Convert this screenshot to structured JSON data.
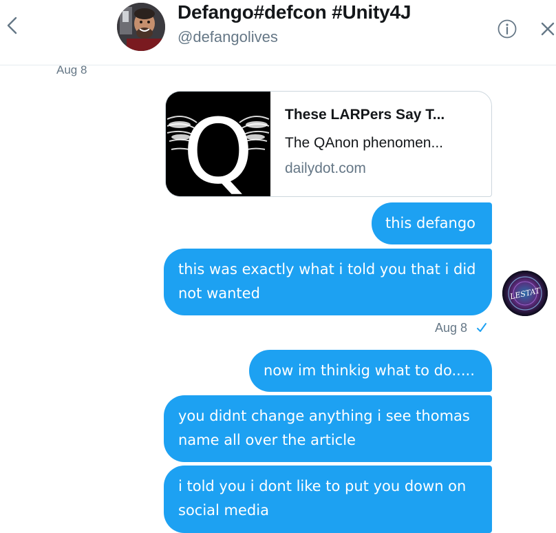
{
  "header": {
    "title": "Defango#defcon #Unity4J",
    "handle": "@defangolives",
    "back_icon": "chevron-left-icon",
    "info_icon": "info-icon",
    "close_icon": "close-icon"
  },
  "date_top": "Aug 8",
  "link_card": {
    "title": "These LARPers Say T...",
    "description": "The QAnon phenomen...",
    "domain": "dailydot.com",
    "thumb_letter": "Q"
  },
  "messages": [
    {
      "text": "this defango"
    },
    {
      "text": "this was exactly what i told you that i did not wanted"
    },
    {
      "text": "now im thinkig what to do....."
    },
    {
      "text": "you didnt change anything i see thomas name all over the article"
    },
    {
      "text": "i told you i dont like to put you down on social media"
    }
  ],
  "timestamp": "Aug 8",
  "read_icon": "checkmark-icon",
  "small_avatar_text": "LESTAT",
  "colors": {
    "bubble": "#1da1f2",
    "muted": "#657786",
    "text": "#14171a",
    "border": "#ccd6dd"
  }
}
